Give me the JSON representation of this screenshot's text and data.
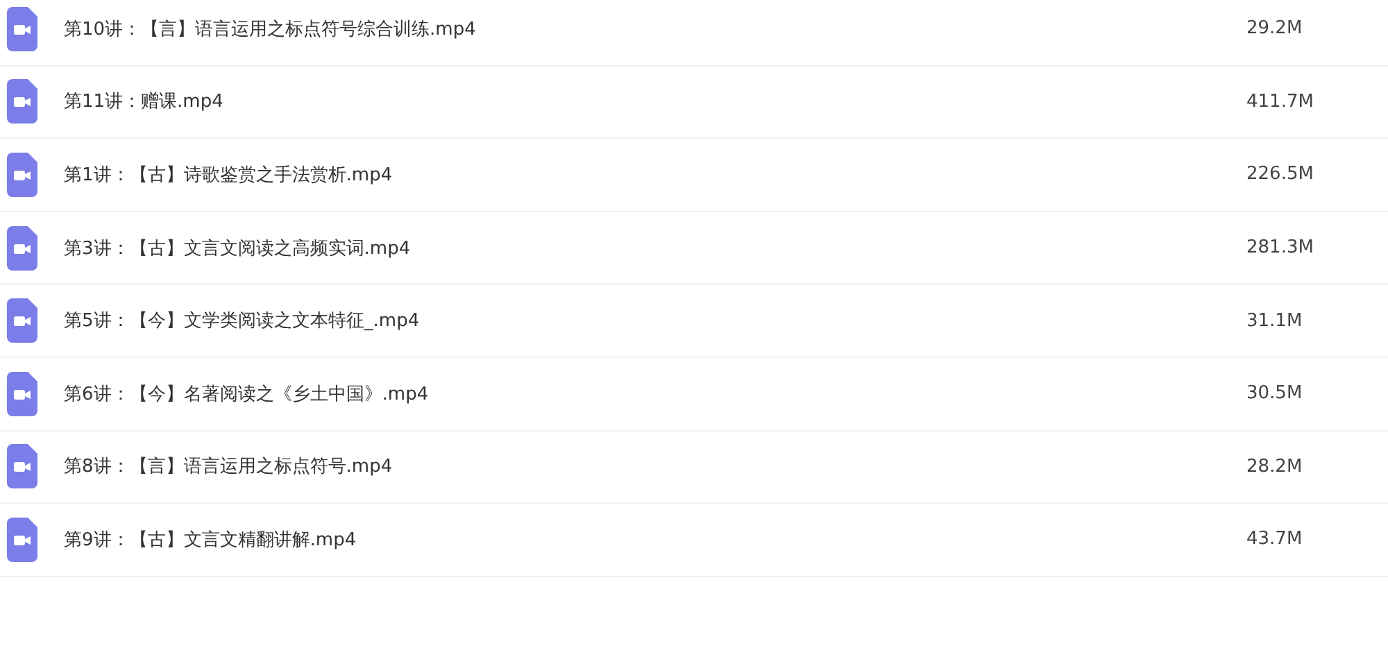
{
  "files": [
    {
      "name": "第10讲：【言】语言运用之标点符号综合训练.mp4",
      "size": "29.2M"
    },
    {
      "name": "第11讲：赠课.mp4",
      "size": "411.7M"
    },
    {
      "name": "第1讲：【古】诗歌鉴赏之手法赏析.mp4",
      "size": "226.5M"
    },
    {
      "name": "第3讲：【古】文言文阅读之高频实词.mp4",
      "size": "281.3M"
    },
    {
      "name": "第5讲：【今】文学类阅读之文本特征_.mp4",
      "size": "31.1M"
    },
    {
      "name": "第6讲：【今】名著阅读之《乡土中国》.mp4",
      "size": "30.5M"
    },
    {
      "name": "第8讲：【言】语言运用之标点符号.mp4",
      "size": "28.2M"
    },
    {
      "name": "第9讲：【古】文言文精翻讲解.mp4",
      "size": "43.7M"
    }
  ]
}
